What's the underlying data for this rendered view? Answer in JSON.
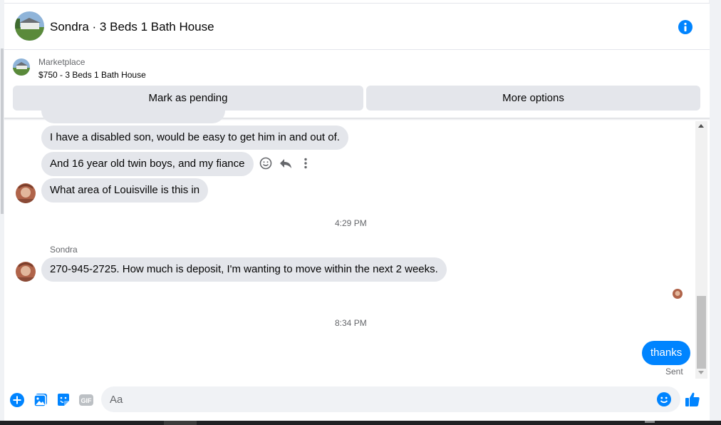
{
  "header": {
    "title": "Sondra · 3 Beds 1 Bath House",
    "avatar_icon": "house-thumbnail-icon",
    "info_icon": "info-icon"
  },
  "listing": {
    "source_label": "Marketplace",
    "price_title": "$750 - 3 Beds 1 Bath House",
    "mark_pending_label": "Mark as pending",
    "more_options_label": "More options"
  },
  "conversation": {
    "messages": [
      {
        "text": "I have a disabled son, would be easy to get him in and out of."
      },
      {
        "text": "And 16 year old twin boys, and my fiance"
      },
      {
        "text": "What area of Louisville is this in"
      }
    ],
    "timestamp_1": "4:29 PM",
    "sender_name": "Sondra",
    "message_4": "270-945-2725. How much is deposit, I'm wanting to move within the next 2 weeks.",
    "timestamp_2": "8:34 PM",
    "my_message": "thanks",
    "status": "Sent"
  },
  "composer": {
    "placeholder": "Aa",
    "icons": [
      "plus-circle-icon",
      "photo-icon",
      "sticker-icon",
      "gif-icon",
      "emoji-icon",
      "thumbs-up-icon"
    ]
  },
  "colors": {
    "accent": "#0084ff",
    "bubble_gray": "#e4e6eb",
    "muted_text": "#65676b"
  }
}
